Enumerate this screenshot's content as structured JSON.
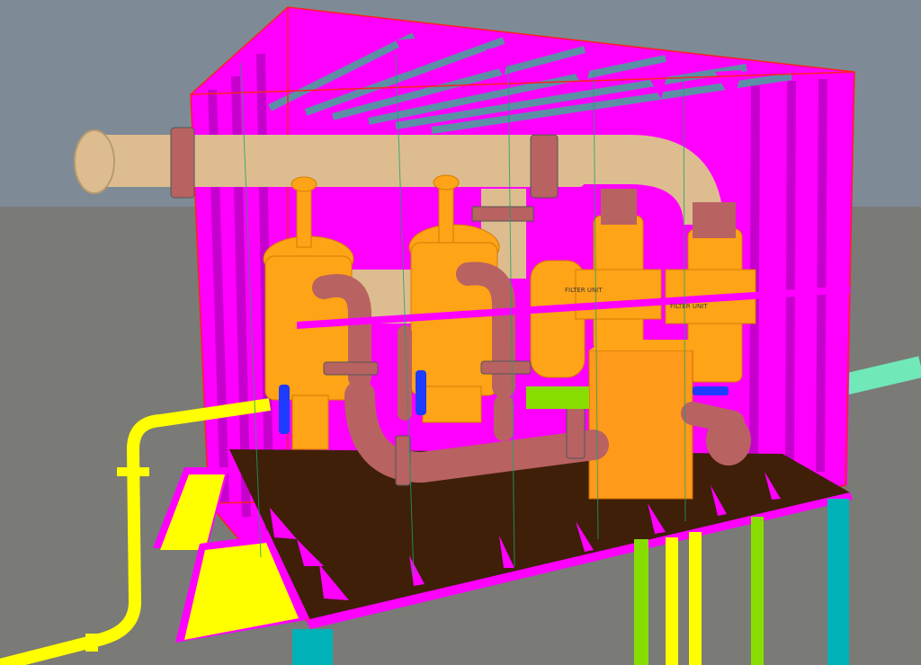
{
  "scene": {
    "colors": {
      "sky": "#7e8b97",
      "ground": "#7a7a77",
      "skid_deck": "#3f1f08",
      "enclosure": "#ff00ff",
      "frame_outline": "#ff2020",
      "main_pipe": "#ddbd8f",
      "vessel": "#ffa317",
      "process_pipe": "#b86262",
      "yellow_pipe": "#ffff00",
      "cyan_support": "#00b2b8",
      "green_pipe": "#88dd00",
      "roof_beam": "#5c8fa6",
      "flange_blue": "#1e3cff",
      "mint_pipe": "#70e8b8",
      "cabinet": "#ff9a1a"
    },
    "labels": {
      "unit_label_a": "FILTER UNIT",
      "unit_label_b": "FILTER UNIT"
    }
  }
}
